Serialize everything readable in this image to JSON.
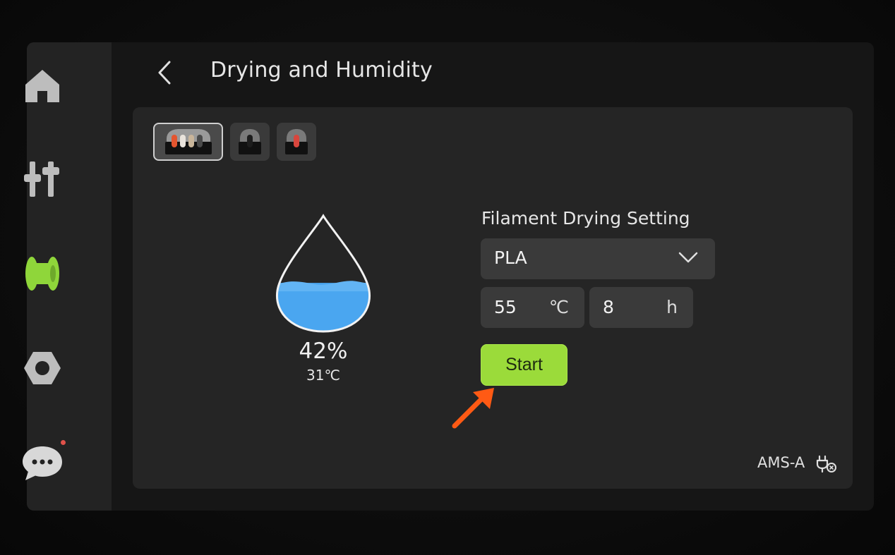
{
  "header": {
    "back_icon": "chevron-left-icon",
    "title": "Drying and Humidity"
  },
  "sidebar": {
    "items": [
      {
        "name": "home",
        "icon": "home-icon",
        "active": false
      },
      {
        "name": "controls",
        "icon": "sliders-icon",
        "active": false
      },
      {
        "name": "filament",
        "icon": "spool-icon",
        "active": true
      },
      {
        "name": "settings",
        "icon": "hex-nut-icon",
        "active": false
      },
      {
        "name": "messages",
        "icon": "chat-bubble-icon",
        "active": false,
        "has_notification": true
      }
    ]
  },
  "trays": [
    {
      "id": "ams-a",
      "active": true,
      "slot_colors": [
        "#e4552f",
        "#e9e3dc",
        "#c9b59a",
        "#4a4a4a"
      ]
    },
    {
      "id": "tray-2",
      "active": false,
      "slot_colors": [
        "#1d1d1d"
      ]
    },
    {
      "id": "tray-3",
      "active": false,
      "slot_colors": [
        "#d9463d"
      ]
    }
  ],
  "humidity": {
    "percent_text": "42%",
    "temperature_text": "31℃",
    "fill_fraction": 0.42,
    "water_color": "#4aa6f0"
  },
  "drying": {
    "section_label": "Filament Drying Setting",
    "material": "PLA",
    "temperature_value": "55",
    "temperature_unit": "℃",
    "duration_value": "8",
    "duration_unit": "h",
    "start_label": "Start"
  },
  "device": {
    "label": "AMS-A",
    "icon": "power-plug-icon"
  },
  "colors": {
    "accent": "#9bdb3a",
    "annotation_arrow": "#ff5a14"
  }
}
